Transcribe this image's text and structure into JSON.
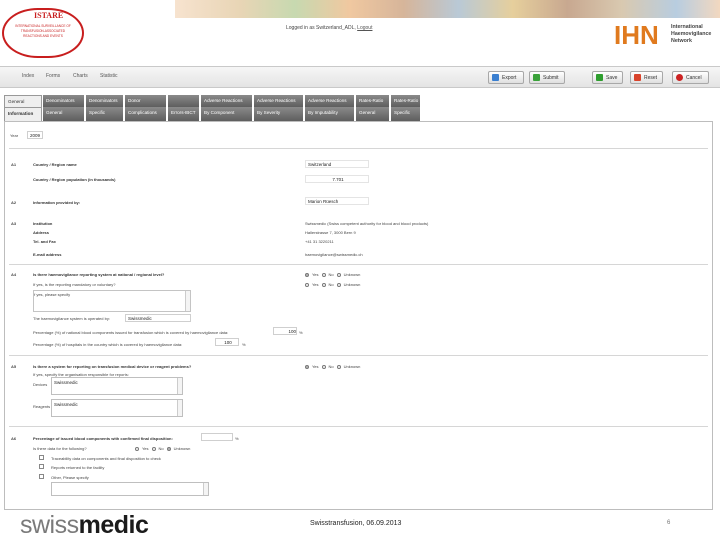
{
  "header": {
    "logo_title": "ISTARE",
    "logo_subtitle": "INTERNATIONAL SURVEILLANCE OF TRANSFUSION-ASSOCIATED REACTIONS AND EVENTS",
    "login_text": "Logged in as Switzerland_ADL",
    "logout_label": "Logout",
    "ihn_logo": "IHN",
    "ihn_text": [
      "International",
      "Haemovigilance",
      "Network"
    ]
  },
  "menu": [
    "Index",
    "Forms",
    "Charts",
    "Statistic"
  ],
  "toolbar": {
    "export_label": "Export",
    "submit_label": "Submit",
    "save_label": "Save",
    "reset_label": "Reset",
    "cancel_label": "Cancel",
    "colors": {
      "export": "#3a7fd0",
      "submit": "#3aa23a",
      "save": "#2e9e2e",
      "reset": "#d9432b",
      "cancel": "#cc2222"
    }
  },
  "tabs_row1": [
    "General",
    "Denominators",
    "Denominators",
    "Donor",
    "",
    "Adverse Reactions",
    "Adverse Reactions",
    "Adverse Reactions",
    "Rates-Ratio",
    "Rates-Ratio"
  ],
  "tabs_row2": [
    "Information",
    "General",
    "Specific",
    "Complications",
    "Errors-IBCT",
    "By Component",
    "By Severity",
    "By Imputability",
    "General",
    "Specific"
  ],
  "form": {
    "year_label": "Year",
    "year_value": "2009",
    "a1": {
      "num": "A1",
      "country_label": "Country / Region name",
      "country_value": "Switzerland",
      "population_label": "Country / Region population (in thousands)",
      "population_value": "7.701"
    },
    "a2": {
      "num": "A2",
      "label": "Information provided by:",
      "value": "Marion Rüesch"
    },
    "a3": {
      "num": "A3",
      "institution_label": "Institution",
      "institution_value": "Swissmedic (Swiss competent authority for blood and blood products)",
      "address_label": "Address",
      "address_value": "Hallerstrasse 7, 3000 Bern 9",
      "tel_label": "Tel. and Fax",
      "tel_value": "+41 31 3220211",
      "email_label": "E-mail address",
      "email_value": "haemovigilance@swissmedic.ch"
    },
    "a4": {
      "num": "A4",
      "question": "Is there haemovigilance reporting system at national / regional level?",
      "sub1": "If yes, is the reporting mandatory or voluntary?",
      "sub2": "If yes, please specify",
      "operated_by_label": "The haemovigilance system is operated by:",
      "operated_by_value": "Swissmedic",
      "pct_label": "Percentage (%) of national blood components issued for transfusion which is covered by haemovigilance data:",
      "pct_value": "100",
      "hosp_label": "Percentage (%) of hospitals in the country which is covered by haemovigilance data:",
      "hosp_value": "100",
      "radio_options": [
        "Yes",
        "No",
        "Unknown"
      ],
      "radio_options2": [
        "Yes",
        "No",
        "Unknown"
      ]
    },
    "a5": {
      "num": "A5",
      "question": "Is there a system for reporting on transfusion medical device or reagent problems?",
      "sub": "If yes, specify the organisation responsible for reports:",
      "device_label": "Devices",
      "device_value": "Swissmedic",
      "reagents_label": "Reagents",
      "reagents_value": "Swissmedic",
      "radio_options": [
        "Yes",
        "No",
        "Unknown"
      ]
    },
    "a6": {
      "num": "A6",
      "question": "Percentage of issued blood components with confirmed final disposition:",
      "sub": "Is there data for the following?",
      "radio_options": [
        "Yes",
        "No",
        "Unknown"
      ],
      "items": [
        "Traceability data on components and final disposition to check",
        "Reports returned to the facility",
        "Other, Please specify"
      ]
    }
  },
  "footer": {
    "brand_part1": "swiss",
    "brand_part2": "medic",
    "caption": "Swisstransfusion, 06.09.2013",
    "page": "6"
  }
}
